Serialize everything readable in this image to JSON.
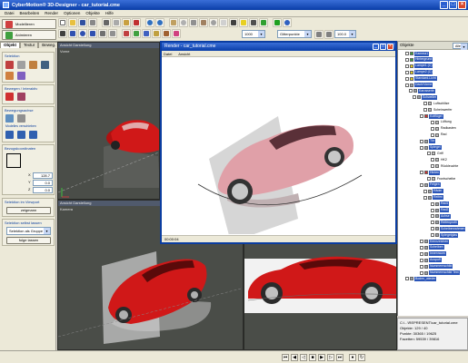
{
  "window": {
    "title": "CyberMotion® 3D-Designer - car_tutorial.cme"
  },
  "menu": [
    "Datei",
    "Bearbeiten",
    "Render",
    "Optionen",
    "Objekte",
    "Hilfe"
  ],
  "toolbar": {
    "modellieren": "Modellieren",
    "animieren": "Animieren",
    "zoom_value": "1000",
    "mode_value": "Gitterpunkte",
    "percent_value": "100.0"
  },
  "left": {
    "tabs": [
      "Objekt",
      "Textur",
      "Beweg."
    ],
    "group_select": "Selektion",
    "group_move": "Bewegen / Interaktiv",
    "group_attach": "Bewegungsachse",
    "attach_labels": [
      "Modelles verschieben"
    ],
    "group_coords": "Bezugskoordinaten",
    "coord_values": [
      "128.7",
      "0.0",
      "0.0"
    ],
    "coord_labels": [
      "X",
      "Y",
      "Z"
    ],
    "group_view": "Selektion im Viewport",
    "view_button": "zeigmann",
    "group_sel": "Selektion selbst lassen",
    "sel_combo": "Selektion als Gruppe",
    "sel_button": "folge lassen"
  },
  "viewports": {
    "top_left": {
      "head": "Ansicht   Darstellung",
      "label": "Vorne"
    },
    "top_right": {
      "head": "Ansicht   Darstellung"
    },
    "bottom_left": {
      "head": "Ansicht   Darstellung",
      "label": "Kamera"
    },
    "bottom_right": {
      "head": "Ansicht   Darstellung"
    }
  },
  "render": {
    "title": "Render - car_tutorial.cme",
    "menu": [
      "Datei",
      "Ansicht"
    ],
    "status": "00:00:04"
  },
  "tree": {
    "header": "Objekte",
    "filter": "Alle",
    "rows": [
      {
        "label": "Kamera1",
        "color": "#3aa23a",
        "sel": true,
        "indent": 8
      },
      {
        "label": "Hintergrund",
        "color": "#3aa23a",
        "sel": true,
        "indent": 8
      },
      {
        "label": "Lampe1 (C)",
        "color": "#e6d020",
        "sel": true,
        "indent": 8
      },
      {
        "label": "Lampe2 (C)",
        "color": "#e6d020",
        "sel": true,
        "indent": 8
      },
      {
        "label": "Standard-Licht",
        "color": "#e6d020",
        "sel": true,
        "indent": 8
      },
      {
        "label": "Dach/Vorne",
        "color": "#9aa0a8",
        "sel": true,
        "indent": 8
      },
      {
        "label": "Karosserie",
        "color": "#9aa0a8",
        "sel": true,
        "indent": 12
      },
      {
        "label": "Schweller",
        "color": "#9aa0a8",
        "sel": true,
        "indent": 16
      },
      {
        "label": "Luftschlitze",
        "color": "#bfbfbf",
        "sel": false,
        "indent": 28
      },
      {
        "label": "Scheinwerfer",
        "color": "#bfbfbf",
        "sel": false,
        "indent": 28
      },
      {
        "label": "Kotflügel",
        "color": "#d03030",
        "sel": true,
        "indent": 24
      },
      {
        "label": "Lüftung",
        "color": "#bfbfbf",
        "sel": false,
        "indent": 36
      },
      {
        "label": "Radkasten",
        "color": "#bfbfbf",
        "sel": false,
        "indent": 36
      },
      {
        "label": "Rad",
        "color": "#bfbfbf",
        "sel": false,
        "indent": 36
      },
      {
        "label": "Tür",
        "color": "#9aa0a8",
        "sel": true,
        "indent": 24
      },
      {
        "label": "Spiegel",
        "color": "#9aa0a8",
        "sel": true,
        "indent": 24
      },
      {
        "label": "Griff",
        "color": "#bfbfbf",
        "sel": false,
        "indent": 32
      },
      {
        "label": "HK2",
        "color": "#bfbfbf",
        "sel": false,
        "indent": 36
      },
      {
        "label": "Rückleuchte",
        "color": "#bfbfbf",
        "sel": false,
        "indent": 36
      },
      {
        "label": "Hinten",
        "color": "#d03030",
        "sel": true,
        "indent": 24
      },
      {
        "label": "Frontscheibe",
        "color": "#bfbfbf",
        "sel": false,
        "indent": 32
      },
      {
        "label": "Felgen",
        "color": "#9aa0a8",
        "sel": true,
        "indent": 24
      },
      {
        "label": "Räder",
        "color": "#9aa0a8",
        "sel": true,
        "indent": 28
      },
      {
        "label": "Reifen",
        "color": "#9aa0a8",
        "sel": true,
        "indent": 28
      },
      {
        "label": "Rad1",
        "color": "#9aa0a8",
        "sel": true,
        "indent": 36
      },
      {
        "label": "Rad2",
        "color": "#9aa0a8",
        "sel": true,
        "indent": 36
      },
      {
        "label": "Achse",
        "color": "#9aa0a8",
        "sel": true,
        "indent": 36
      },
      {
        "label": "Reifenprofil",
        "color": "#9aa0a8",
        "sel": true,
        "indent": 36
      },
      {
        "label": "Scheibenrahmen",
        "color": "#9aa0a8",
        "sel": true,
        "indent": 36
      },
      {
        "label": "Spiegelglas",
        "color": "#9aa0a8",
        "sel": true,
        "indent": 36
      },
      {
        "label": "Kennzeichen",
        "color": "#9aa0a8",
        "sel": true,
        "indent": 24
      },
      {
        "label": "Scheiben",
        "color": "#9aa0a8",
        "sel": true,
        "indent": 24
      },
      {
        "label": "Innenraum",
        "color": "#9aa0a8",
        "sel": true,
        "indent": 24
      },
      {
        "label": "Auspuff",
        "color": "#9aa0a8",
        "sel": true,
        "indent": 24
      },
      {
        "label": "Nummernschild",
        "color": "#9aa0a8",
        "sel": true,
        "indent": 24
      },
      {
        "label": "Nummernschild Text",
        "color": "#9aa0a8",
        "sel": true,
        "indent": 24
      },
      {
        "label": "Boden_wieder",
        "color": "#9aa0a8",
        "sel": true,
        "indent": 8
      }
    ]
  },
  "info": {
    "path": "C:\\...\\REPRESENT\\car_tutorial.cme",
    "objects": "Objekte: 129 / 40",
    "points": "Punkte: 30365 / 19625",
    "faces": "Facetten: 59539 / 39816"
  },
  "colors": {
    "title": "#0a3ea8",
    "selection": "#2a55b8",
    "car": "#d01818",
    "viewport": "#4a4d48"
  }
}
